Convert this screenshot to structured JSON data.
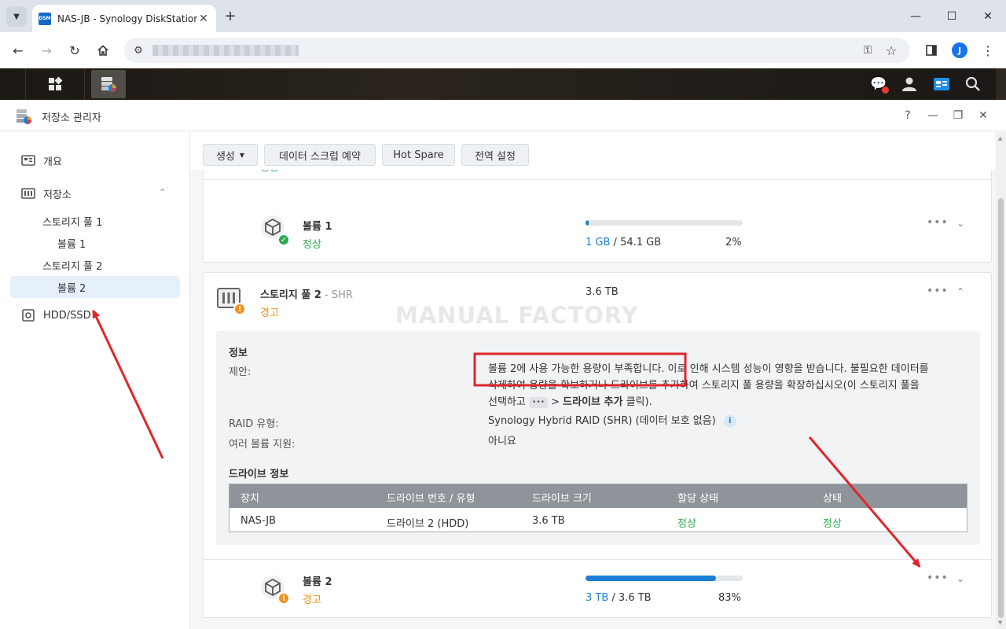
{
  "browser": {
    "tab_title": "NAS-JB - Synology DiskStation",
    "favicon_text": "DSM",
    "profile_initial": "J"
  },
  "window": {
    "title": "저장소 관리자",
    "help_label": "?"
  },
  "sidebar": {
    "items": [
      {
        "label": "개요"
      },
      {
        "label": "저장소"
      },
      {
        "label": "스토리지 풀 1"
      },
      {
        "label": "볼륨 1"
      },
      {
        "label": "스토리지 풀 2"
      },
      {
        "label": "볼륨 2"
      },
      {
        "label": "HDD/SSD"
      }
    ]
  },
  "actions": {
    "create": "생성",
    "scrub": "데이터 스크럽 예약",
    "hotspare": "Hot Spare",
    "global": "전역 설정"
  },
  "pool1": {
    "status": "정상"
  },
  "volume1": {
    "name": "볼륨 1",
    "status": "정상",
    "used": "1 GB",
    "sep": " / ",
    "total": "54.1 GB",
    "percent": "2%",
    "usage_fraction": 0.02
  },
  "pool2": {
    "name": "스토리지 풀 2",
    "sep": " - ",
    "raid_short": "SHR",
    "size": "3.6 TB",
    "status": "경고",
    "info_title": "정보",
    "suggestion_label": "제안:",
    "suggestion_line1": "볼륨 2에 사용 가능한 용량이 부족합니다. 이로 인해 시스템 성능이 영향을 받습니다. 불필요한 데이터를",
    "suggestion_line2": "삭제하여 용량을 확보하거나 드라이브를 추가하여 스토리지 풀 용량을 확장하십시오(이 스토리지 풀을",
    "suggestion_line3_a": "선택하고",
    "suggestion_chip": "•••",
    "suggestion_line3_b": "> ",
    "suggestion_line3_bold": "드라이브 추가",
    "suggestion_line3_c": " 클릭).",
    "raid_label": "RAID 유형:",
    "raid_value": "Synology Hybrid RAID (SHR) (데이터 보호 없음)",
    "info_icon": "i",
    "multi_label": "여러 볼륨 지원:",
    "multi_value": "아니요",
    "drive_info_title": "드라이브 정보",
    "table": {
      "headers": [
        "장치",
        "드라이브 번호 / 유형",
        "드라이브 크기",
        "할당 상태",
        "상태"
      ],
      "rows": [
        [
          "NAS-JB",
          "드라이브 2 (HDD)",
          "3.6 TB",
          "정상",
          "정상"
        ]
      ]
    }
  },
  "volume2": {
    "name": "볼륨 2",
    "status": "경고",
    "used": "3 TB",
    "sep": " / ",
    "total": "3.6 TB",
    "percent": "83%",
    "usage_fraction": 0.83
  },
  "watermark": "MANUAL FACTORY",
  "colors": {
    "ok": "#2fa84f",
    "warn": "#f0901f",
    "accent": "#1a7fd4",
    "annotation": "#e0262b"
  }
}
